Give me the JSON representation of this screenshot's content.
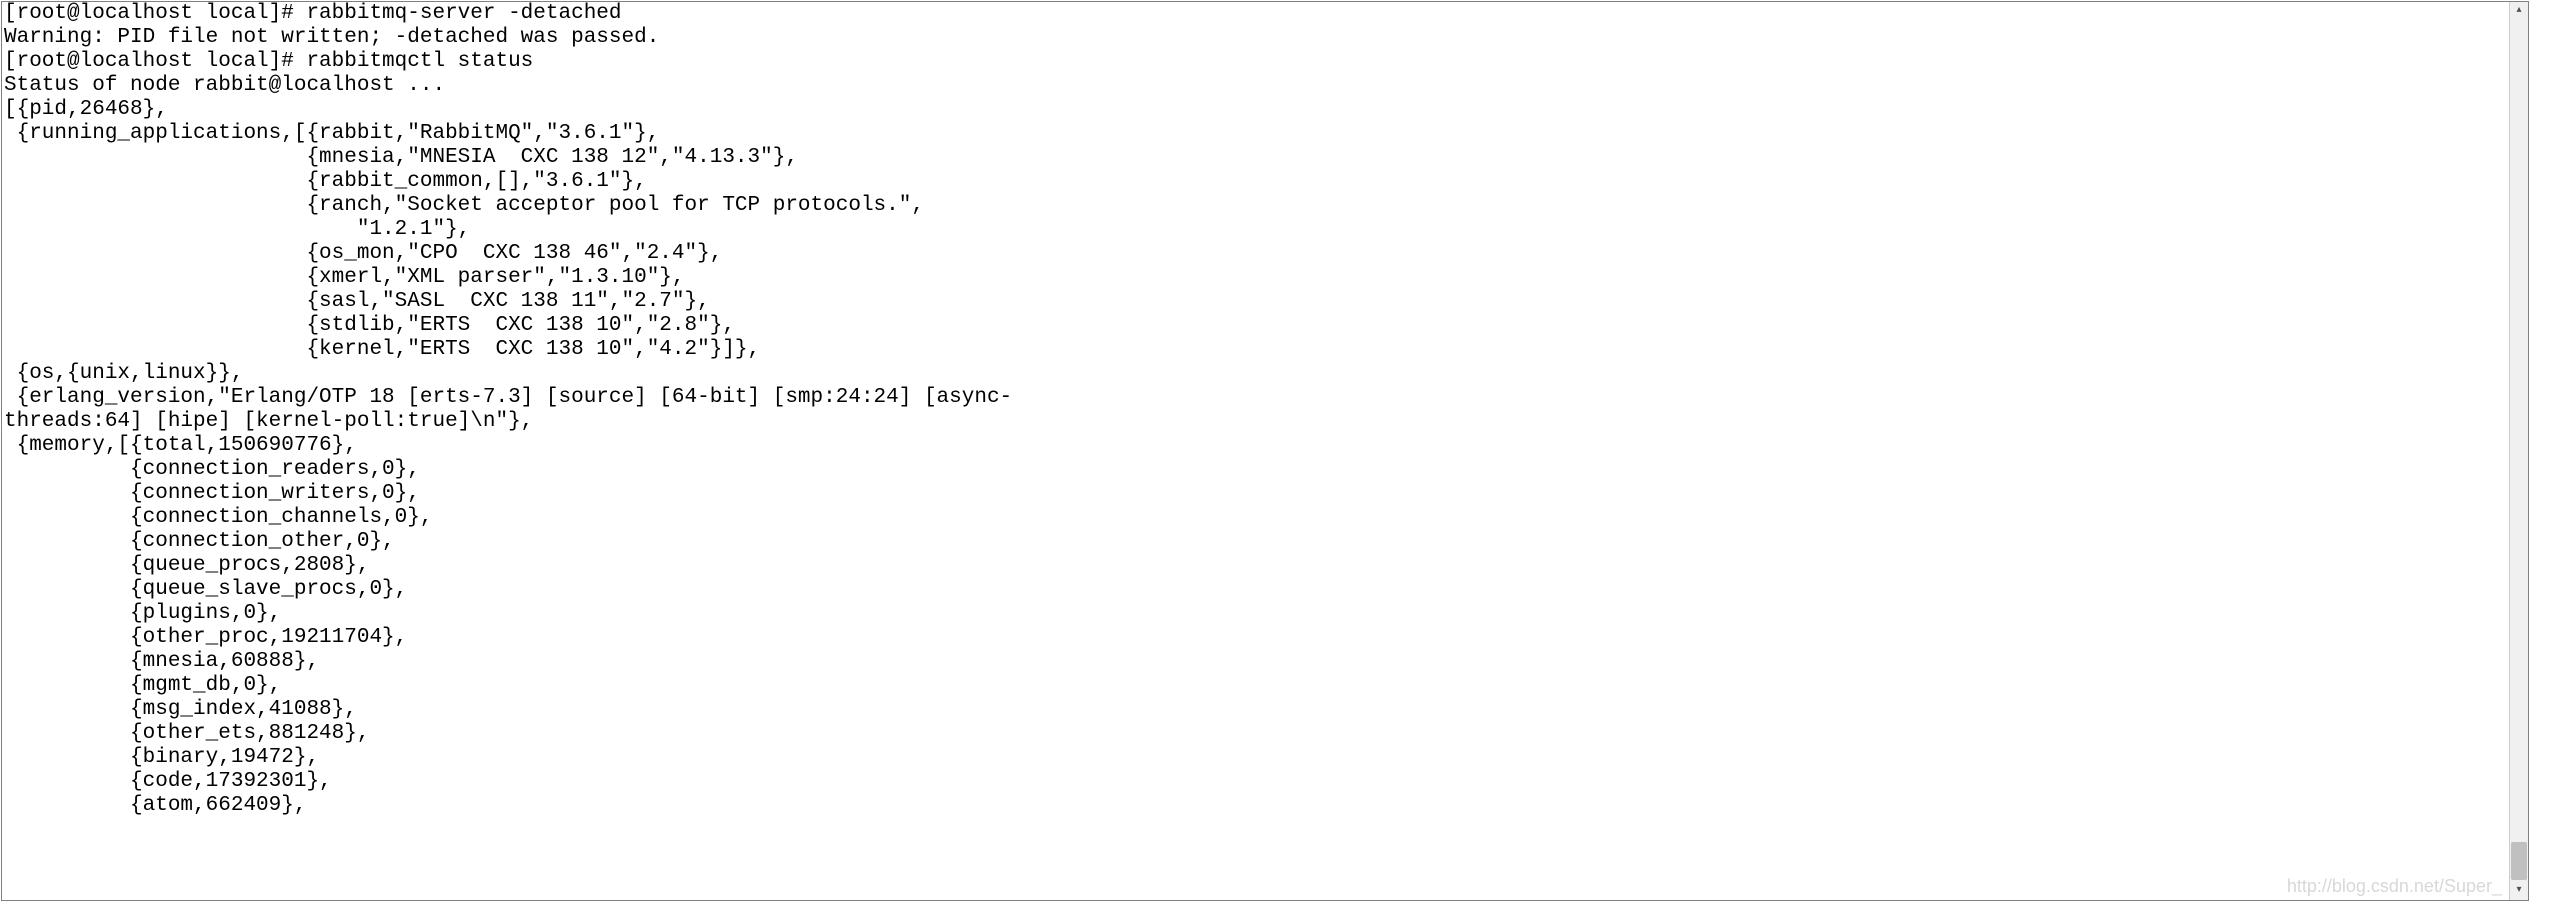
{
  "terminal": {
    "lines": [
      "[root@localhost local]# rabbitmq-server -detached",
      "Warning: PID file not written; -detached was passed.",
      "[root@localhost local]# rabbitmqctl status",
      "Status of node rabbit@localhost ...",
      "[{pid,26468},",
      " {running_applications,[{rabbit,\"RabbitMQ\",\"3.6.1\"},",
      "                        {mnesia,\"MNESIA  CXC 138 12\",\"4.13.3\"},",
      "                        {rabbit_common,[],\"3.6.1\"},",
      "                        {ranch,\"Socket acceptor pool for TCP protocols.\",",
      "                            \"1.2.1\"},",
      "                        {os_mon,\"CPO  CXC 138 46\",\"2.4\"},",
      "                        {xmerl,\"XML parser\",\"1.3.10\"},",
      "                        {sasl,\"SASL  CXC 138 11\",\"2.7\"},",
      "                        {stdlib,\"ERTS  CXC 138 10\",\"2.8\"},",
      "                        {kernel,\"ERTS  CXC 138 10\",\"4.2\"}]},",
      " {os,{unix,linux}},",
      " {erlang_version,\"Erlang/OTP 18 [erts-7.3] [source] [64-bit] [smp:24:24] [async-",
      "threads:64] [hipe] [kernel-poll:true]\\n\"},",
      " {memory,[{total,150690776},",
      "          {connection_readers,0},",
      "          {connection_writers,0},",
      "          {connection_channels,0},",
      "          {connection_other,0},",
      "          {queue_procs,2808},",
      "          {queue_slave_procs,0},",
      "          {plugins,0},",
      "          {other_proc,19211704},",
      "          {mnesia,60888},",
      "          {mgmt_db,0},",
      "          {msg_index,41088},",
      "          {other_ets,881248},",
      "          {binary,19472},",
      "          {code,17392301},",
      "          {atom,662409},"
    ]
  },
  "watermark": "http://blog.csdn.net/Super_"
}
